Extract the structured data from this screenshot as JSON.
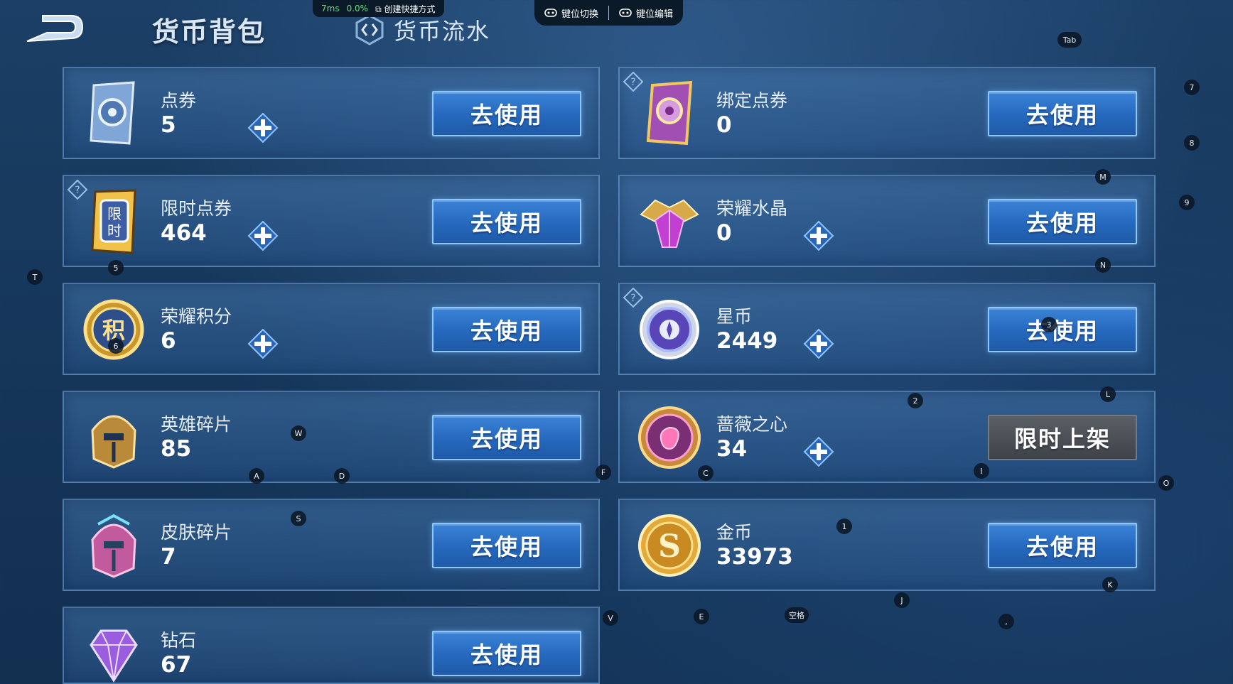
{
  "header": {
    "title": "货币背包",
    "flow_tab_label": "货币流水"
  },
  "perf": {
    "latency": "7ms",
    "loss": "0.0%",
    "shortcut_label": "创建快捷方式"
  },
  "keymap": {
    "switch_label": "键位切换",
    "edit_label": "键位编辑"
  },
  "currencies": [
    {
      "name": "点券",
      "amount": "5",
      "button": "去使用",
      "has_plus": true,
      "has_help": false,
      "icon": "ticket-icon"
    },
    {
      "name": "绑定点券",
      "amount": "0",
      "button": "去使用",
      "has_plus": false,
      "has_help": true,
      "icon": "bound-ticket-icon"
    },
    {
      "name": "限时点券",
      "amount": "464",
      "button": "去使用",
      "has_plus": true,
      "has_help": true,
      "icon": "limited-ticket-icon"
    },
    {
      "name": "荣耀水晶",
      "amount": "0",
      "button": "去使用",
      "has_plus": true,
      "has_help": false,
      "icon": "crystal-icon"
    },
    {
      "name": "荣耀积分",
      "amount": "6",
      "button": "去使用",
      "has_plus": true,
      "has_help": false,
      "icon": "points-icon"
    },
    {
      "name": "星币",
      "amount": "2449",
      "button": "去使用",
      "has_plus": true,
      "has_help": true,
      "icon": "star-coin-icon"
    },
    {
      "name": "英雄碎片",
      "amount": "85",
      "button": "去使用",
      "has_plus": false,
      "has_help": false,
      "icon": "hero-shard-icon"
    },
    {
      "name": "蔷薇之心",
      "amount": "34",
      "button": "限时上架",
      "has_plus": true,
      "has_help": false,
      "icon": "rose-heart-icon"
    },
    {
      "name": "皮肤碎片",
      "amount": "7",
      "button": "去使用",
      "has_plus": false,
      "has_help": false,
      "icon": "skin-shard-icon"
    },
    {
      "name": "金币",
      "amount": "33973",
      "button": "去使用",
      "has_plus": false,
      "has_help": false,
      "icon": "gold-coin-icon"
    },
    {
      "name": "钻石",
      "amount": "67",
      "button": "去使用",
      "has_plus": false,
      "has_help": false,
      "icon": "diamond-icon"
    }
  ],
  "hotkeys": [
    "Tab",
    "7",
    "8",
    "M",
    "9",
    "N",
    "T",
    "5",
    "6",
    "3",
    "W",
    "2",
    "L",
    "A",
    "D",
    "F",
    "C",
    "I",
    "O",
    "S",
    "1",
    "K",
    "V",
    "E",
    "空格",
    "J",
    ","
  ],
  "colors": {
    "use_button": "#2568bd",
    "limited_button": "#4a4f56",
    "background": "#16375b"
  }
}
